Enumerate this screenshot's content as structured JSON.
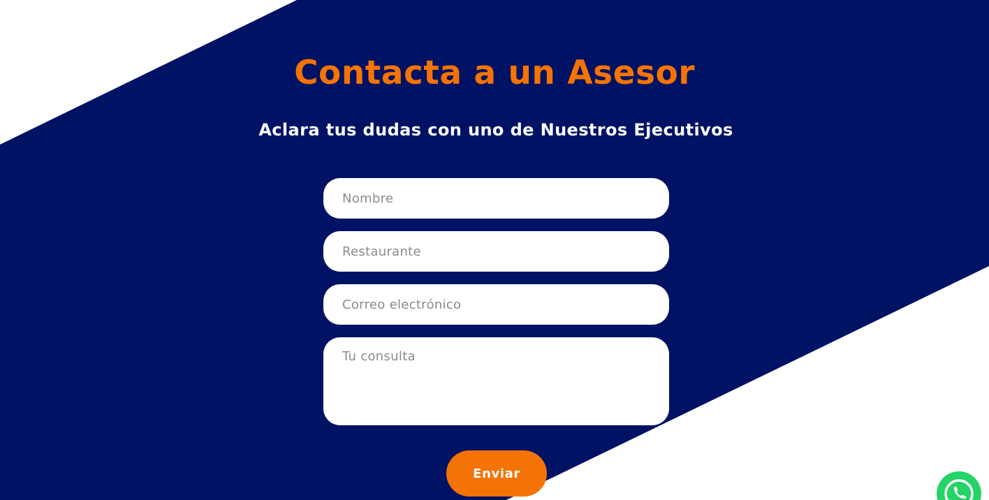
{
  "colors": {
    "background": "#ffffff",
    "band": "#001263",
    "accent": "#f47305",
    "heading_text": "#f47305",
    "subheading_text": "#ffffff",
    "whatsapp": "#25d366"
  },
  "contact_section": {
    "title": "Contacta a un Asesor",
    "subtitle": "Aclara tus dudas con uno de Nuestros Ejecutivos"
  },
  "form": {
    "name": {
      "value": "",
      "placeholder": "Nombre"
    },
    "restaurant": {
      "value": "",
      "placeholder": "Restaurante"
    },
    "email": {
      "value": "",
      "placeholder": "Correo electrónico"
    },
    "message": {
      "value": "",
      "placeholder": "Tu consulta"
    },
    "submit_label": "Enviar"
  },
  "floating_widget": {
    "icon": "whatsapp-icon"
  }
}
